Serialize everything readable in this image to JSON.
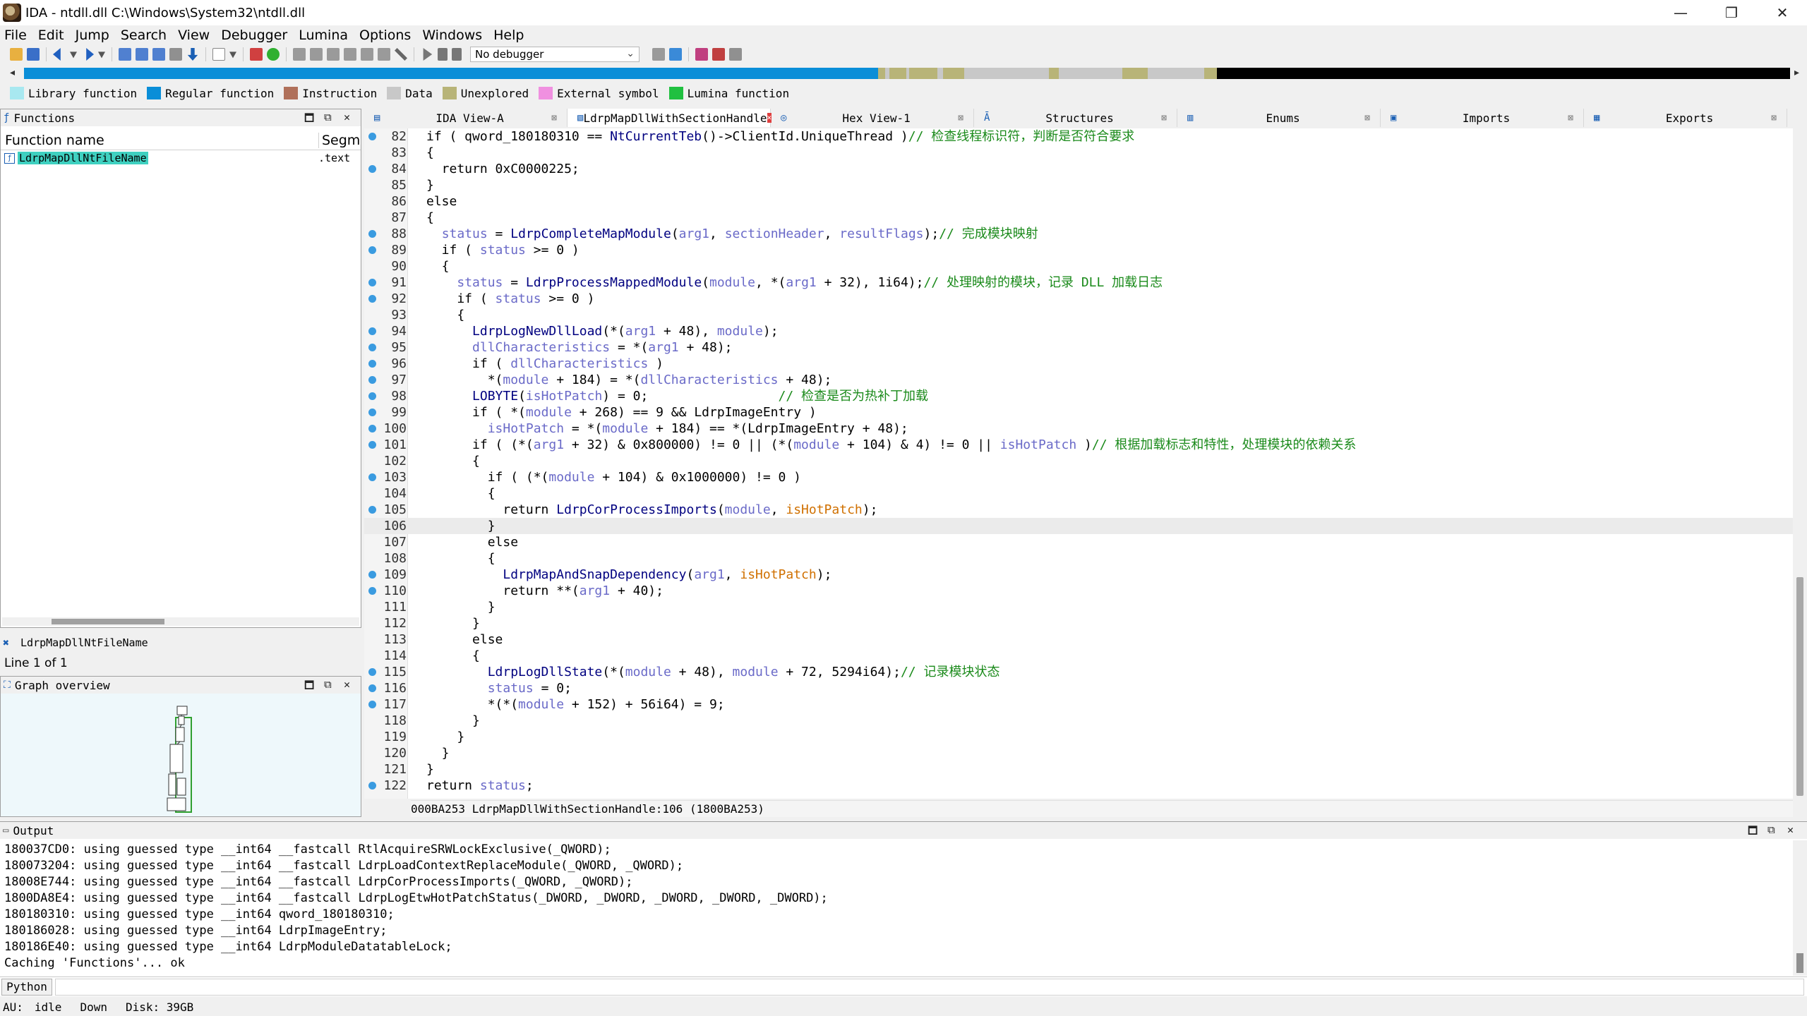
{
  "window": {
    "title": "IDA - ntdll.dll C:\\Windows\\System32\\ntdll.dll",
    "controls": {
      "minimize": "—",
      "maximize": "❐",
      "close": "✕"
    }
  },
  "menu": [
    "File",
    "Edit",
    "Jump",
    "Search",
    "View",
    "Debugger",
    "Lumina",
    "Options",
    "Windows",
    "Help"
  ],
  "toolbar": {
    "debugger_select": "No debugger"
  },
  "legend": [
    {
      "label": "Library function",
      "color": "#a8e8f0"
    },
    {
      "label": "Regular function",
      "color": "#0a8ed8"
    },
    {
      "label": "Instruction",
      "color": "#b0705a"
    },
    {
      "label": "Data",
      "color": "#c8c8c8"
    },
    {
      "label": "Unexplored",
      "color": "#b8b478"
    },
    {
      "label": "External symbol",
      "color": "#f090e0"
    },
    {
      "label": "Lumina function",
      "color": "#20c040"
    }
  ],
  "functions_panel": {
    "title": "Functions",
    "col_name": "Function name",
    "col_segment": "Segme",
    "rows": [
      {
        "name": "LdrpMapDllNtFileName",
        "segment": ".text"
      }
    ],
    "filter_text": "LdrpMapDllNtFileName",
    "line_count": "Line 1 of 1"
  },
  "graph_panel": {
    "title": "Graph overview"
  },
  "tabs": [
    {
      "label": "IDA View-A",
      "active": false
    },
    {
      "label": "LdrpMapDllWithSectionHandle",
      "active": true
    },
    {
      "label": "Hex View-1",
      "active": false
    },
    {
      "label": "Structures",
      "active": false
    },
    {
      "label": "Enums",
      "active": false
    },
    {
      "label": "Imports",
      "active": false
    },
    {
      "label": "Exports",
      "active": false
    }
  ],
  "code_status": "000BA253 LdrpMapDllWithSectionHandle:106 (1800BA253)",
  "output": {
    "title": "Output",
    "lines": [
      "180037CD0: using guessed type __int64 __fastcall RtlAcquireSRWLockExclusive(_QWORD);",
      "180073204: using guessed type __int64 __fastcall LdrpLoadContextReplaceModule(_QWORD, _QWORD);",
      "18008E744: using guessed type __int64 __fastcall LdrpCorProcessImports(_QWORD, _QWORD);",
      "1800DA8E4: using guessed type __int64 __fastcall LdrpLogEtwHotPatchStatus(_DWORD, _DWORD, _DWORD, _DWORD, _DWORD);",
      "180180310: using guessed type __int64 qword_180180310;",
      "180186028: using guessed type __int64 LdrpImageEntry;",
      "180186E40: using guessed type __int64 LdrpModuleDatatableLock;",
      "Caching 'Functions'... ok"
    ]
  },
  "python": {
    "label": "Python"
  },
  "status": {
    "au": "AU:",
    "state": "idle",
    "direction": "Down",
    "disk": "Disk: 39GB"
  },
  "code_lines": [
    {
      "n": "82",
      "dot": true,
      "t": "if ( qword_180180310 == NtCurrentTeb()->ClientId.UniqueThread )// 检查线程标识符，判断是否符合要求"
    },
    {
      "n": "83",
      "dot": false,
      "t": "{"
    },
    {
      "n": "84",
      "dot": true,
      "t": "  return 0xC0000225;"
    },
    {
      "n": "85",
      "dot": false,
      "t": "}"
    },
    {
      "n": "86",
      "dot": false,
      "t": "else"
    },
    {
      "n": "87",
      "dot": false,
      "t": "{"
    },
    {
      "n": "88",
      "dot": true,
      "t": "  status = LdrpCompleteMapModule(arg1, sectionHeader, resultFlags);// 完成模块映射"
    },
    {
      "n": "89",
      "dot": true,
      "t": "  if ( status >= 0 )"
    },
    {
      "n": "90",
      "dot": false,
      "t": "  {"
    },
    {
      "n": "91",
      "dot": true,
      "t": "    status = LdrpProcessMappedModule(module, *(arg1 + 32), 1i64);// 处理映射的模块，记录 DLL 加载日志"
    },
    {
      "n": "92",
      "dot": true,
      "t": "    if ( status >= 0 )"
    },
    {
      "n": "93",
      "dot": false,
      "t": "    {"
    },
    {
      "n": "94",
      "dot": true,
      "t": "      LdrpLogNewDllLoad(*(arg1 + 48), module);"
    },
    {
      "n": "95",
      "dot": true,
      "t": "      dllCharacteristics = *(arg1 + 48);"
    },
    {
      "n": "96",
      "dot": true,
      "t": "      if ( dllCharacteristics )"
    },
    {
      "n": "97",
      "dot": true,
      "t": "        *(module + 184) = *(dllCharacteristics + 48);"
    },
    {
      "n": "98",
      "dot": true,
      "t": "      LOBYTE(isHotPatch) = 0;                 // 检查是否为热补丁加载"
    },
    {
      "n": "99",
      "dot": true,
      "t": "      if ( *(module + 268) == 9 && LdrpImageEntry )"
    },
    {
      "n": "100",
      "dot": true,
      "t": "        isHotPatch = *(module + 184) == *(LdrpImageEntry + 48);"
    },
    {
      "n": "101",
      "dot": true,
      "t": "      if ( (*(arg1 + 32) & 0x800000) != 0 || (*(module + 104) & 4) != 0 || isHotPatch )// 根据加载标志和特性，处理模块的依赖关系"
    },
    {
      "n": "102",
      "dot": false,
      "t": "      {"
    },
    {
      "n": "103",
      "dot": true,
      "t": "        if ( (*(module + 104) & 0x1000000) != 0 )"
    },
    {
      "n": "104",
      "dot": false,
      "t": "        {"
    },
    {
      "n": "105",
      "dot": true,
      "t": "          return LdrpCorProcessImports(module, isHotPatch);"
    },
    {
      "n": "106",
      "dot": false,
      "t": "        }",
      "hl": true
    },
    {
      "n": "107",
      "dot": false,
      "t": "        else"
    },
    {
      "n": "108",
      "dot": false,
      "t": "        {"
    },
    {
      "n": "109",
      "dot": true,
      "t": "          LdrpMapAndSnapDependency(arg1, isHotPatch);"
    },
    {
      "n": "110",
      "dot": true,
      "t": "          return **(arg1 + 40);"
    },
    {
      "n": "111",
      "dot": false,
      "t": "        }"
    },
    {
      "n": "112",
      "dot": false,
      "t": "      }"
    },
    {
      "n": "113",
      "dot": false,
      "t": "      else"
    },
    {
      "n": "114",
      "dot": false,
      "t": "      {"
    },
    {
      "n": "115",
      "dot": true,
      "t": "        LdrpLogDllState(*(module + 48), module + 72, 5294i64);// 记录模块状态"
    },
    {
      "n": "116",
      "dot": true,
      "t": "        status = 0;"
    },
    {
      "n": "117",
      "dot": true,
      "t": "        *(*(module + 152) + 56i64) = 9;"
    },
    {
      "n": "118",
      "dot": false,
      "t": "      }"
    },
    {
      "n": "119",
      "dot": false,
      "t": "    }"
    },
    {
      "n": "120",
      "dot": false,
      "t": "  }"
    },
    {
      "n": "121",
      "dot": false,
      "t": "}"
    },
    {
      "n": "122",
      "dot": true,
      "t": "return status;"
    }
  ]
}
